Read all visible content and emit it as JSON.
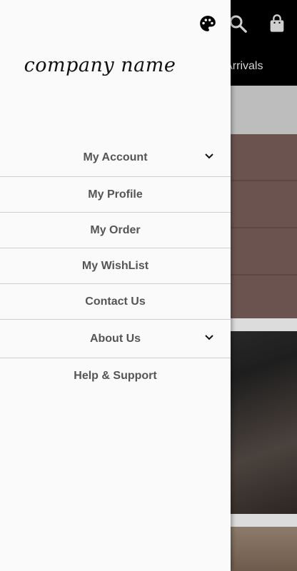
{
  "drawer": {
    "company_name": "company name",
    "items": [
      {
        "label": "My Account",
        "expandable": true
      },
      {
        "label": "My Profile",
        "expandable": false
      },
      {
        "label": "My Order",
        "expandable": false
      },
      {
        "label": "My WishList",
        "expandable": false
      },
      {
        "label": "Contact Us",
        "expandable": false
      },
      {
        "label": "About Us",
        "expandable": true
      },
      {
        "label": "Help & Support",
        "expandable": false
      }
    ]
  },
  "background": {
    "tab_label": "w Arrivals"
  },
  "icons": {
    "palette": "palette-icon",
    "search": "search-icon",
    "bag": "shopping-bag-icon",
    "chevron": "chevron-down-icon"
  },
  "colors": {
    "drawer_bg": "#fafafa",
    "topbar_bg": "#000000",
    "menu_text": "#555555",
    "divider": "#cfcfcf"
  }
}
